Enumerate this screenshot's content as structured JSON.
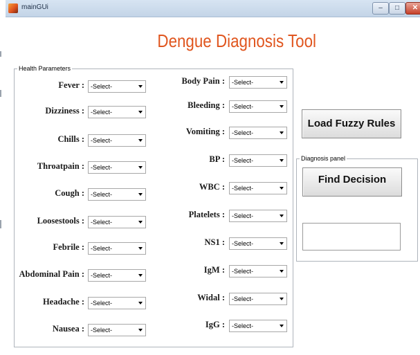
{
  "window": {
    "title": "mainGUi",
    "minimize": "–",
    "maximize": "□",
    "close": "✕"
  },
  "app": {
    "title": "Dengue Diagnosis Tool"
  },
  "health_panel": {
    "legend": "Health Parameters",
    "select_placeholder": "-Select-",
    "left_fields": [
      {
        "label": "Fever :",
        "value": "-Select-"
      },
      {
        "label": "Dizziness :",
        "value": "-Select-"
      },
      {
        "label": "Chills :",
        "value": "-Select-"
      },
      {
        "label": "Throatpain :",
        "value": "-Select-"
      },
      {
        "label": "Cough :",
        "value": "-Select-"
      },
      {
        "label": "Loosestools :",
        "value": "-Select-"
      },
      {
        "label": "Febrile :",
        "value": "-Select-"
      },
      {
        "label": "Abdominal Pain :",
        "value": "-Select-"
      },
      {
        "label": "Headache :",
        "value": "-Select-"
      },
      {
        "label": "Nausea :",
        "value": "-Select-"
      }
    ],
    "right_fields": [
      {
        "label": "Body Pain :",
        "value": "-Select-"
      },
      {
        "label": "Bleeding :",
        "value": "-Select-"
      },
      {
        "label": "Vomiting :",
        "value": "-Select-"
      },
      {
        "label": "BP :",
        "value": "-Select-"
      },
      {
        "label": "WBC :",
        "value": "-Select-"
      },
      {
        "label": "Platelets :",
        "value": "-Select-"
      },
      {
        "label": "NS1 :",
        "value": "-Select-"
      },
      {
        "label": "IgM :",
        "value": "-Select-"
      },
      {
        "label": "Widal :",
        "value": "-Select-"
      },
      {
        "label": "IgG :",
        "value": "-Select-"
      }
    ]
  },
  "buttons": {
    "load_rules": "Load Fuzzy Rules",
    "find_decision": "Find Decision"
  },
  "diagnosis_panel": {
    "legend": "Diagnosis panel",
    "result": ""
  }
}
